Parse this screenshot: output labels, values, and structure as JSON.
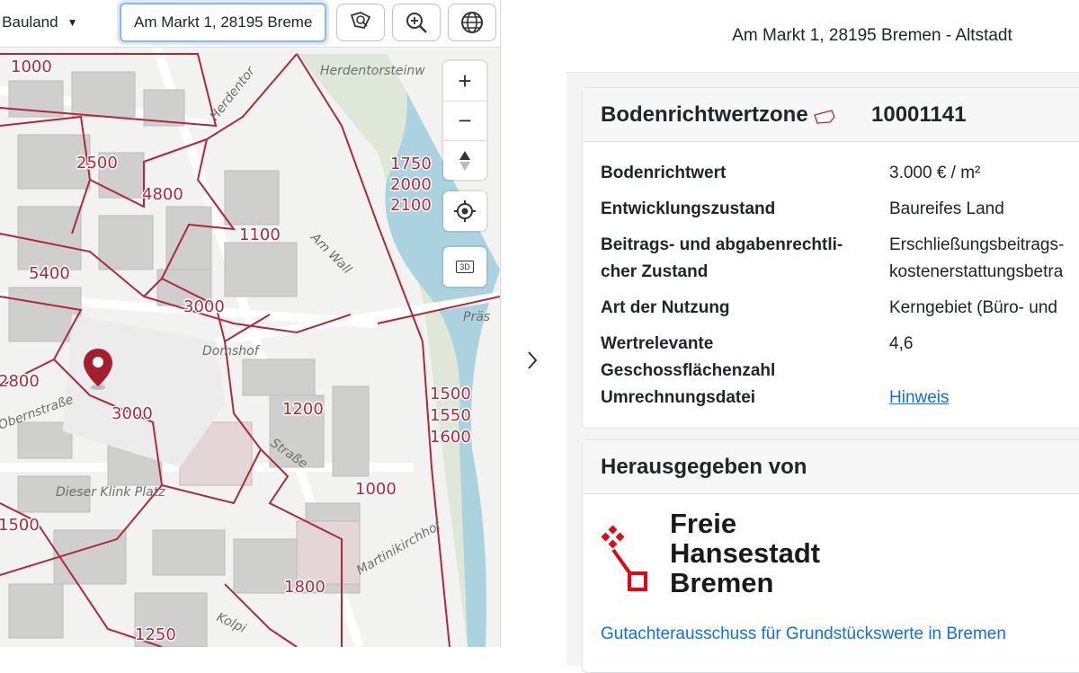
{
  "toolbar": {
    "landuse_select_value": "t: Bauland",
    "address_value": "Am Markt 1, 28195 Bremen - Altstadt",
    "buttons": [
      {
        "name": "polygon-search-icon"
      },
      {
        "name": "zoom-search-icon"
      },
      {
        "name": "globe-icon"
      }
    ]
  },
  "map": {
    "zone_labels": [
      "1000",
      "2500",
      "4800",
      "1100",
      "5400",
      "3000",
      "2800",
      "3000",
      "1500",
      "1550",
      "1600",
      "1200",
      "1000",
      "1500",
      "1800",
      "1250",
      "1750",
      "2000",
      "2100"
    ],
    "street_labels": [
      "Herdentorsteinw",
      "Herdentor",
      "Am Wall",
      "Präs",
      "Domshof",
      "Dieser Klink Platz",
      "Straße",
      "Martinikirchhof",
      "Obernstraße",
      "Kolpi"
    ],
    "controls": {
      "zoom_in": "+",
      "zoom_out": "−",
      "three_d": "3D"
    },
    "marker_icon": "location-pin-icon"
  },
  "panel": {
    "address_heading": "Am Markt 1, 28195 Bremen - Altstadt",
    "zone_card": {
      "title": "Bodenrichtwertzone",
      "zone_id": "10001141",
      "rows": [
        {
          "key": "Bodenrichtwert",
          "value": "3.000 € / m²"
        },
        {
          "key": "Entwicklungszustand",
          "value": "Baureifes Land"
        },
        {
          "key": "Beitrags- und abgabenrechtli-",
          "key2": "cher Zustand",
          "value": "Erschließungsbeitrags-",
          "value2": "kostenerstattungsbetra"
        },
        {
          "key": "Art der Nutzung",
          "value": "Kerngebiet (Büro- und"
        },
        {
          "key": "Wertrelevante",
          "key2": "Geschossflächenzahl",
          "value": "4,6"
        },
        {
          "key": "Umrechnungsdatei",
          "value": "Hinweis"
        }
      ]
    },
    "publisher_card": {
      "title": "Herausgegeben von",
      "logo_text": [
        "Freie",
        "Hansestadt",
        "Bremen"
      ],
      "link": "Gutachterausschuss für Grundstückswerte in Bremen"
    }
  },
  "colors": {
    "zone_line": "#b0293a",
    "accent_link": "#0d6efd",
    "logo_red": "#e30613"
  }
}
